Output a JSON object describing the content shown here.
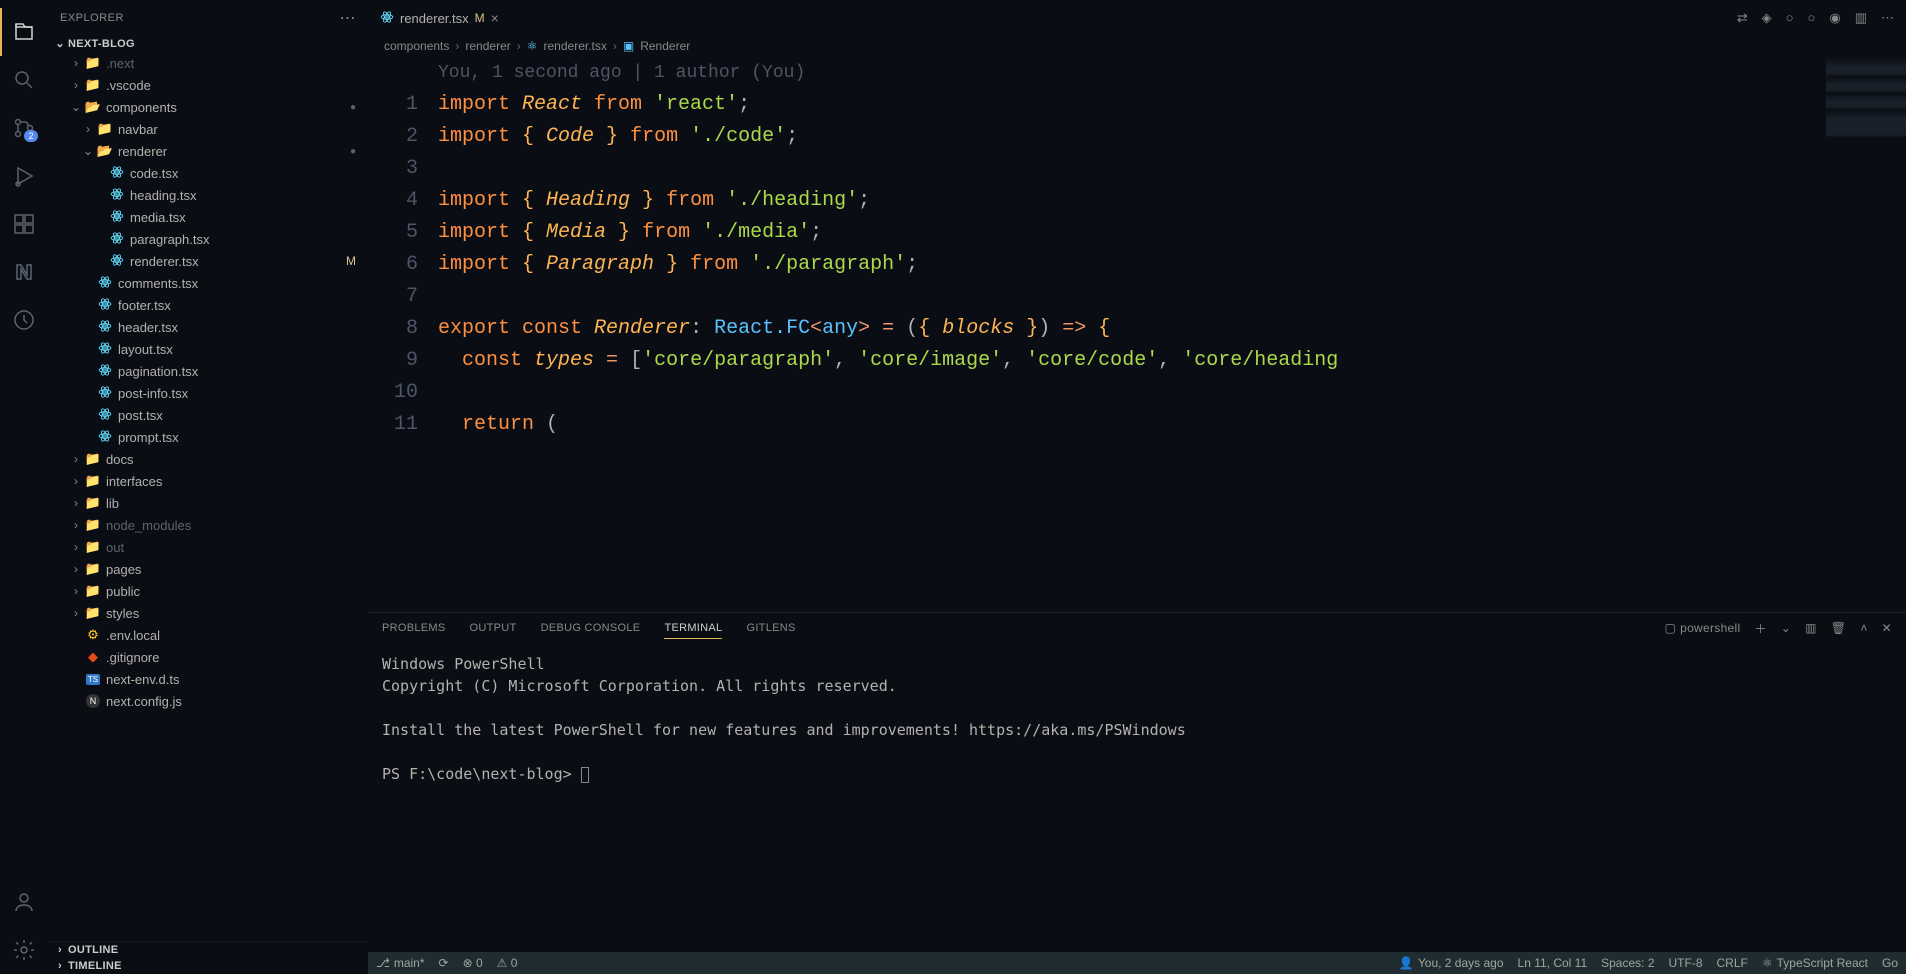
{
  "sidebar": {
    "title": "EXPLORER",
    "project": "NEXT-BLOG",
    "tree": [
      {
        "indent": 1,
        "chev": ">",
        "icon": "folder",
        "label": ".next",
        "muted": true
      },
      {
        "indent": 1,
        "chev": ">",
        "icon": "folder",
        "label": ".vscode"
      },
      {
        "indent": 1,
        "chev": "v",
        "icon": "folder-open",
        "label": "components",
        "dot": true
      },
      {
        "indent": 2,
        "chev": ">",
        "icon": "folder",
        "label": "navbar"
      },
      {
        "indent": 2,
        "chev": "v",
        "icon": "folder-open",
        "label": "renderer",
        "dot": true
      },
      {
        "indent": 3,
        "chev": "",
        "icon": "react",
        "label": "code.tsx"
      },
      {
        "indent": 3,
        "chev": "",
        "icon": "react",
        "label": "heading.tsx"
      },
      {
        "indent": 3,
        "chev": "",
        "icon": "react",
        "label": "media.tsx"
      },
      {
        "indent": 3,
        "chev": "",
        "icon": "react",
        "label": "paragraph.tsx"
      },
      {
        "indent": 3,
        "chev": "",
        "icon": "react",
        "label": "renderer.tsx",
        "mod": "M"
      },
      {
        "indent": 2,
        "chev": "",
        "icon": "react",
        "label": "comments.tsx"
      },
      {
        "indent": 2,
        "chev": "",
        "icon": "react",
        "label": "footer.tsx"
      },
      {
        "indent": 2,
        "chev": "",
        "icon": "react",
        "label": "header.tsx"
      },
      {
        "indent": 2,
        "chev": "",
        "icon": "react",
        "label": "layout.tsx"
      },
      {
        "indent": 2,
        "chev": "",
        "icon": "react",
        "label": "pagination.tsx"
      },
      {
        "indent": 2,
        "chev": "",
        "icon": "react",
        "label": "post-info.tsx"
      },
      {
        "indent": 2,
        "chev": "",
        "icon": "react",
        "label": "post.tsx"
      },
      {
        "indent": 2,
        "chev": "",
        "icon": "react",
        "label": "prompt.tsx"
      },
      {
        "indent": 1,
        "chev": ">",
        "icon": "folder",
        "label": "docs"
      },
      {
        "indent": 1,
        "chev": ">",
        "icon": "folder",
        "label": "interfaces"
      },
      {
        "indent": 1,
        "chev": ">",
        "icon": "folder-yellow",
        "label": "lib"
      },
      {
        "indent": 1,
        "chev": ">",
        "icon": "folder",
        "label": "node_modules",
        "muted": true
      },
      {
        "indent": 1,
        "chev": ">",
        "icon": "folder",
        "label": "out",
        "muted": true
      },
      {
        "indent": 1,
        "chev": ">",
        "icon": "folder-yellow",
        "label": "pages"
      },
      {
        "indent": 1,
        "chev": ">",
        "icon": "folder",
        "label": "public"
      },
      {
        "indent": 1,
        "chev": ">",
        "icon": "folder",
        "label": "styles"
      },
      {
        "indent": 1,
        "chev": "",
        "icon": "env",
        "label": ".env.local"
      },
      {
        "indent": 1,
        "chev": "",
        "icon": "git",
        "label": ".gitignore"
      },
      {
        "indent": 1,
        "chev": "",
        "icon": "ts",
        "label": "next-env.d.ts"
      },
      {
        "indent": 1,
        "chev": "",
        "icon": "js",
        "label": "next.config.js"
      }
    ],
    "outline": "OUTLINE",
    "timeline": "TIMELINE"
  },
  "tabs": {
    "active": {
      "icon": "react",
      "label": "renderer.tsx",
      "modified": "M"
    }
  },
  "breadcrumb": [
    "components",
    "renderer",
    "renderer.tsx",
    "Renderer"
  ],
  "editor": {
    "gitlens": "You, 1 second ago | 1 author (You)",
    "lines": [
      {
        "n": 1,
        "tokens": [
          [
            "kw",
            "import"
          ],
          [
            "",
            ""
          ],
          [
            "fn",
            " React"
          ],
          [
            "",
            ""
          ],
          [
            "kw",
            " from"
          ],
          [
            "",
            ""
          ],
          [
            "str",
            " 'react'"
          ],
          [
            "punct",
            ";"
          ]
        ]
      },
      {
        "n": 2,
        "tokens": [
          [
            "kw",
            "import"
          ],
          [
            "brace",
            " {"
          ],
          [
            "fn",
            " Code"
          ],
          [
            "brace",
            " }"
          ],
          [
            "kw",
            " from"
          ],
          [
            "str",
            " './code'"
          ],
          [
            "punct",
            ";"
          ]
        ]
      },
      {
        "n": 3,
        "tokens": [
          [
            "",
            ""
          ]
        ]
      },
      {
        "n": 4,
        "tokens": [
          [
            "kw",
            "import"
          ],
          [
            "brace",
            " {"
          ],
          [
            "fn",
            " Heading"
          ],
          [
            "brace",
            " }"
          ],
          [
            "kw",
            " from"
          ],
          [
            "str",
            " './heading'"
          ],
          [
            "punct",
            ";"
          ]
        ]
      },
      {
        "n": 5,
        "tokens": [
          [
            "kw",
            "import"
          ],
          [
            "brace",
            " {"
          ],
          [
            "fn",
            " Media"
          ],
          [
            "brace",
            " }"
          ],
          [
            "kw",
            " from"
          ],
          [
            "str",
            " './media'"
          ],
          [
            "punct",
            ";"
          ]
        ]
      },
      {
        "n": 6,
        "tokens": [
          [
            "kw",
            "import"
          ],
          [
            "brace",
            " {"
          ],
          [
            "fn",
            " Paragraph"
          ],
          [
            "brace",
            " }"
          ],
          [
            "kw",
            " from"
          ],
          [
            "str",
            " './paragraph'"
          ],
          [
            "punct",
            ";"
          ]
        ]
      },
      {
        "n": 7,
        "tokens": [
          [
            "",
            ""
          ]
        ]
      },
      {
        "n": 8,
        "tokens": [
          [
            "kw",
            "export"
          ],
          [
            "const",
            " const"
          ],
          [
            "ident",
            " Renderer"
          ],
          [
            "punct",
            ":"
          ],
          [
            "type",
            " React.FC"
          ],
          [
            "op",
            "<"
          ],
          [
            "generic",
            "any"
          ],
          [
            "op",
            ">"
          ],
          [
            "op",
            " ="
          ],
          [
            "paren",
            " ("
          ],
          [
            "brace",
            "{"
          ],
          [
            "ident",
            " blocks"
          ],
          [
            "brace",
            " }"
          ],
          [
            "paren",
            ")"
          ],
          [
            "op",
            " =>"
          ],
          [
            "brace",
            " {"
          ]
        ]
      },
      {
        "n": 9,
        "tokens": [
          [
            "",
            "  "
          ],
          [
            "const",
            "const"
          ],
          [
            "ident",
            " types"
          ],
          [
            "op",
            " ="
          ],
          [
            "paren",
            " ["
          ],
          [
            "str",
            "'core/paragraph'"
          ],
          [
            "punct",
            ", "
          ],
          [
            "str",
            "'core/image'"
          ],
          [
            "punct",
            ", "
          ],
          [
            "str",
            "'core/code'"
          ],
          [
            "punct",
            ", "
          ],
          [
            "str",
            "'core/heading"
          ]
        ]
      },
      {
        "n": 10,
        "tokens": [
          [
            "",
            ""
          ]
        ]
      },
      {
        "n": 11,
        "tokens": [
          [
            "",
            "  "
          ],
          [
            "kw",
            "return"
          ],
          [
            "paren",
            " ("
          ]
        ]
      }
    ]
  },
  "panel": {
    "tabs": [
      "PROBLEMS",
      "OUTPUT",
      "DEBUG CONSOLE",
      "TERMINAL",
      "GITLENS"
    ],
    "activeTab": "TERMINAL",
    "shell": "powershell",
    "terminal": [
      "Windows PowerShell",
      "Copyright (C) Microsoft Corporation. All rights reserved.",
      "",
      "Install the latest PowerShell for new features and improvements! https://aka.ms/PSWindows",
      "",
      "PS F:\\code\\next-blog> "
    ]
  },
  "status": {
    "branch": "main*",
    "sync": "⟳",
    "errors": "⊗ 0",
    "warnings": "⚠ 0",
    "blame": "You, 2 days ago",
    "position": "Ln 11, Col 11",
    "spaces": "Spaces: 2",
    "encoding": "UTF-8",
    "eol": "CRLF",
    "lang": "TypeScript React",
    "go": "Go"
  },
  "scm_badge": "2"
}
